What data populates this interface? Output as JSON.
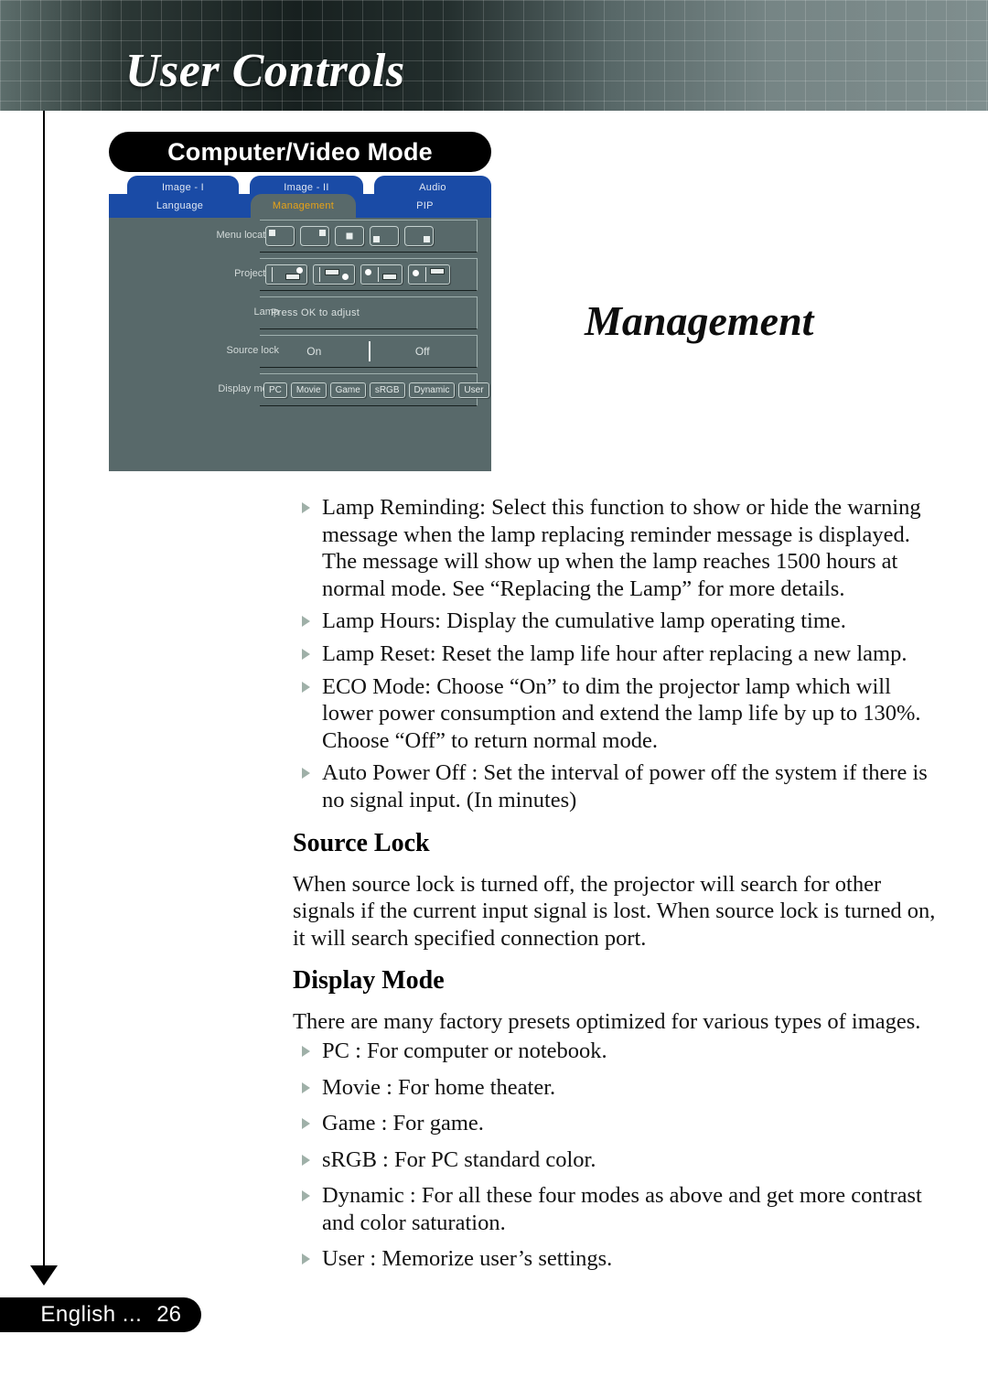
{
  "header": {
    "title": "User Controls"
  },
  "footer": {
    "language": "English ...",
    "page_number": "26"
  },
  "osd": {
    "banner_label": "Computer/Video Mode",
    "tabs_top": [
      "Image - I",
      "Image - II",
      "Audio"
    ],
    "tabs_bottom": [
      "Language",
      "Management",
      "PIP"
    ],
    "active_tab": "Management",
    "active_tab_color": "#e8a317",
    "tab_bg_color": "#1a4ba6",
    "panel_bg_color": "#58696a",
    "rows": [
      {
        "label": "Menu location",
        "type": "icon-set",
        "options": [
          "top-left",
          "top-right",
          "center",
          "bottom-left",
          "bottom-right"
        ]
      },
      {
        "label": "Projection",
        "type": "icon-set",
        "options": [
          "front-table",
          "rear-table",
          "front-ceiling",
          "rear-ceiling"
        ]
      },
      {
        "label": "Lamp",
        "type": "text",
        "value": "Press OK  to adjust"
      },
      {
        "label": "Source lock",
        "type": "toggle",
        "options": [
          "On",
          "Off"
        ]
      },
      {
        "label": "Display mode",
        "type": "buttons",
        "options": [
          "PC",
          "Movie",
          "Game",
          "sRGB",
          "Dynamic",
          "User"
        ]
      }
    ]
  },
  "main": {
    "heading": "Management",
    "bullets_top": [
      "Lamp Reminding: Select this function to show or hide the warning message when the lamp replacing reminder message is displayed. The message will show up when the lamp reaches 1500 hours at normal mode. See “Replacing the Lamp” for more details.",
      "Lamp Hours: Display the cumulative lamp operating time.",
      "Lamp Reset: Reset the lamp life hour after replacing a new lamp.",
      "ECO Mode: Choose “On” to dim the projector lamp which will lower power consumption and extend the lamp life by up to 130%. Choose “Off” to return normal mode.",
      "Auto Power Off : Set the interval of power off the system if there is no signal input. (In minutes)"
    ],
    "source_lock": {
      "heading": "Source Lock",
      "paragraph": "When source lock is turned off, the projector will search for other signals if the current input signal is lost. When source lock is turned on, it will search specified connection port."
    },
    "display_mode": {
      "heading": "Display Mode",
      "paragraph": "There are many factory presets optimized for various types of images.",
      "bullets": [
        "PC : For computer or notebook.",
        "Movie : For home theater.",
        "Game : For game.",
        "sRGB : For PC standard color.",
        "Dynamic : For all these four modes as above and get more contrast and color saturation.",
        "User : Memorize user’s settings."
      ]
    }
  }
}
